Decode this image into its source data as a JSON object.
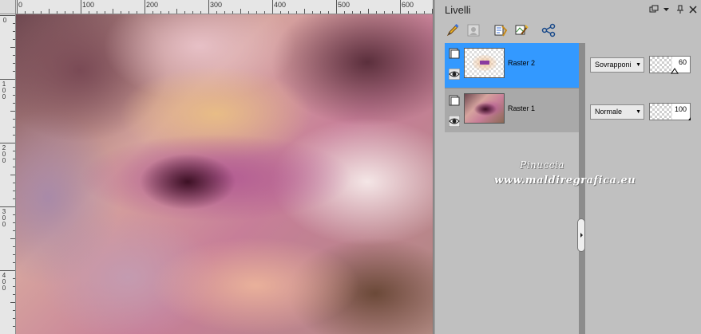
{
  "ruler": {
    "top_labels": [
      "0",
      "100",
      "200",
      "300",
      "400",
      "500",
      "600"
    ],
    "left_labels": [
      "0",
      "100",
      "200",
      "300",
      "400"
    ]
  },
  "layers_panel": {
    "title": "Livelli",
    "title_buttons": [
      "minimize-dock-icon",
      "dropdown-caret-icon",
      "pin-icon",
      "close-icon"
    ],
    "toolbar_icons": [
      "brush-edit-icon",
      "mask-icon",
      "layer-properties-icon",
      "layer-adjust-icon",
      "share-icon"
    ],
    "layers": [
      {
        "name": "Raster 2",
        "blend_mode": "Sovrapponi",
        "opacity": "60",
        "selected": true
      },
      {
        "name": "Raster 1",
        "blend_mode": "Normale",
        "opacity": "100",
        "selected": false
      }
    ],
    "colors": {
      "selected": "#3399ff",
      "unselected": "#a9a9a9",
      "panel": "#c0c0c0"
    }
  },
  "watermark": {
    "line1": "Pinuccia",
    "line2": "www.maldiregrafica.eu"
  }
}
